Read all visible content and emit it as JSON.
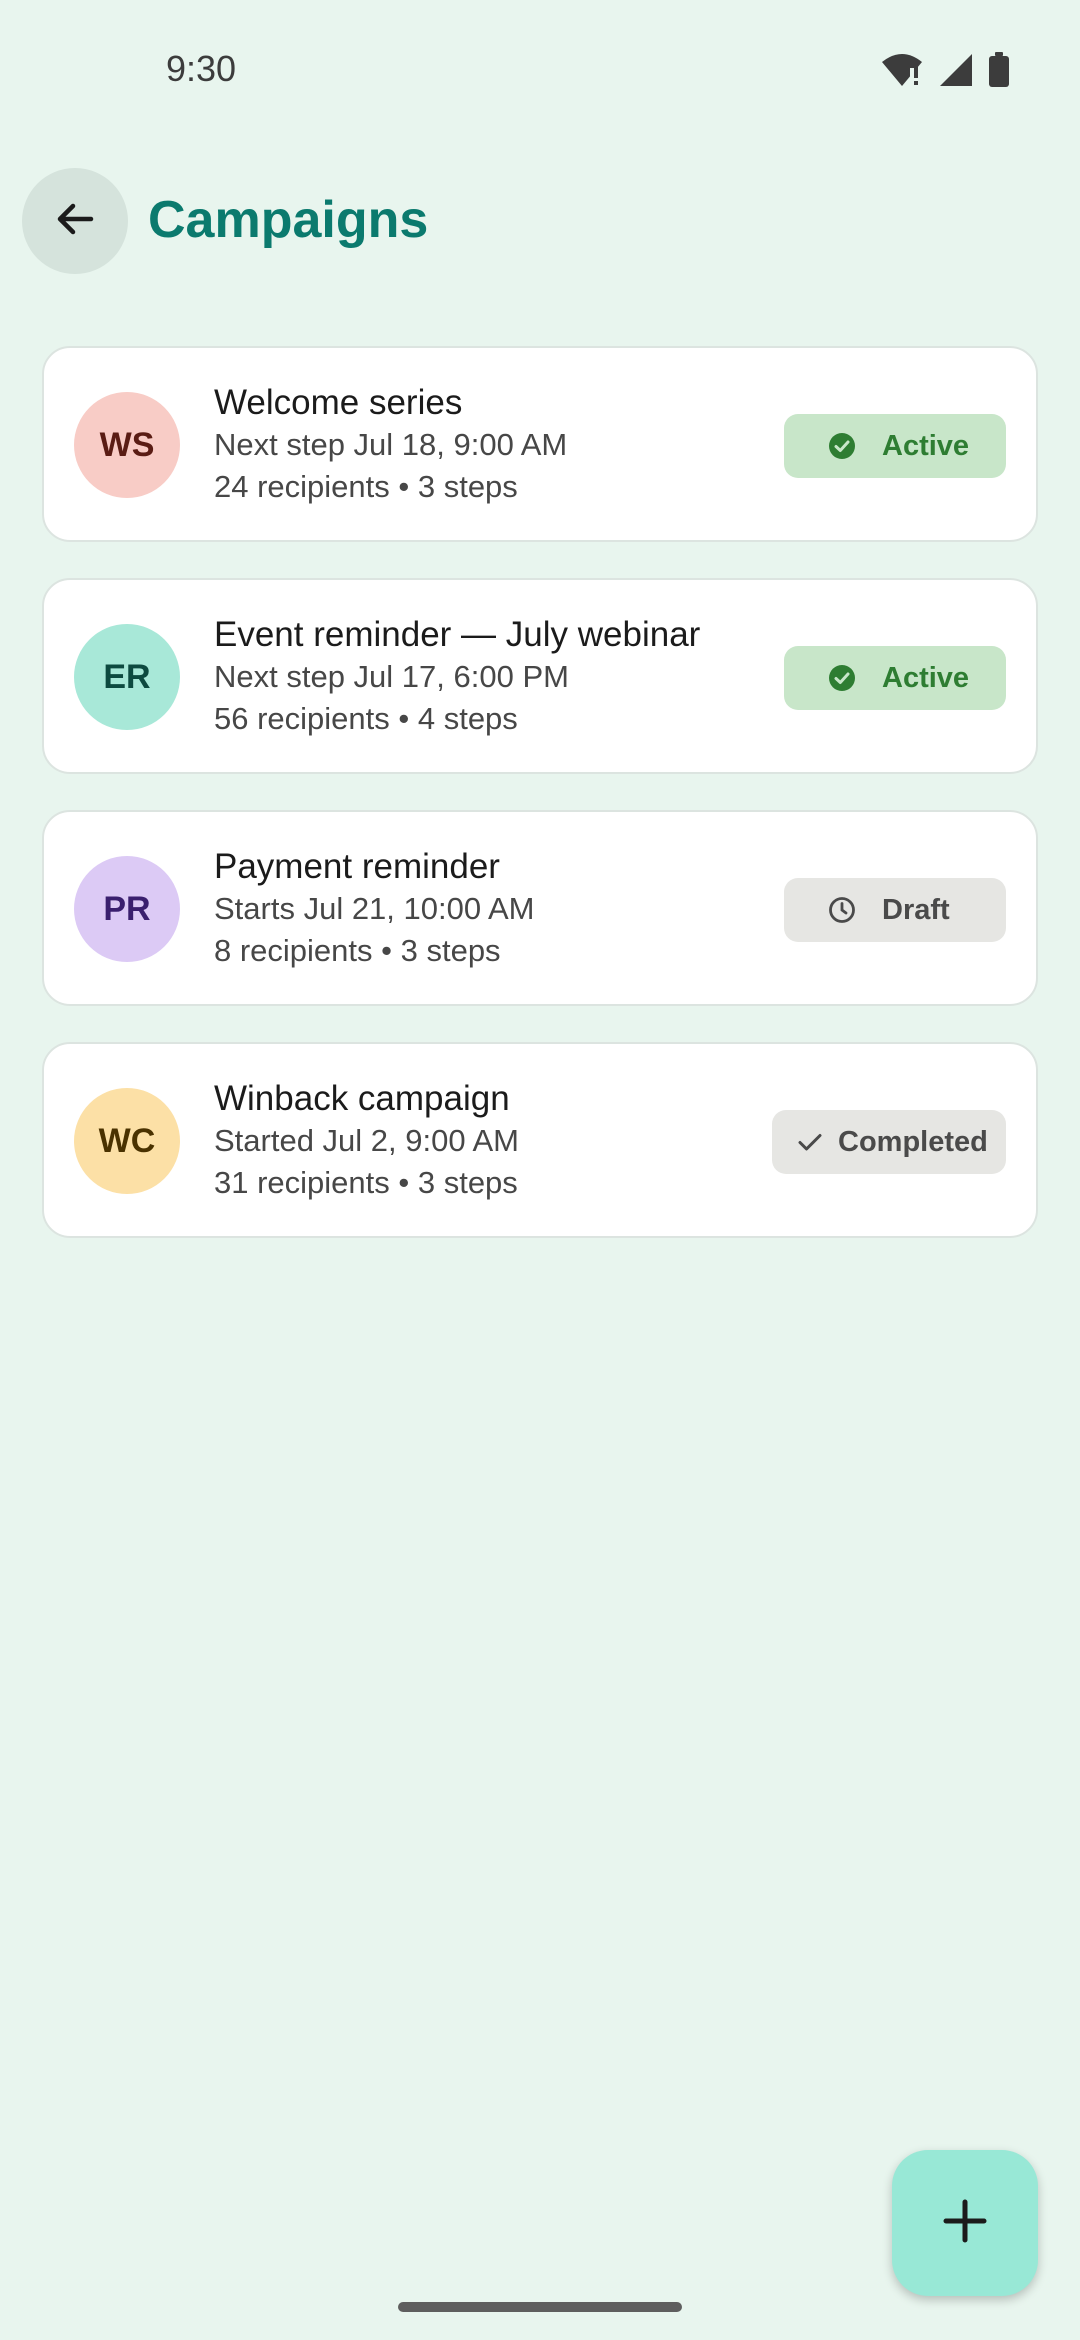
{
  "status_bar": {
    "time": "9:30",
    "icons": [
      "wifi-icon",
      "signal-icon",
      "battery-icon"
    ]
  },
  "app_bar": {
    "back_icon": "arrow-left-icon",
    "title": "Campaigns"
  },
  "campaigns": [
    {
      "initials": "WS",
      "avatar_bg": "#F8CCC6",
      "avatar_fg": "#5A1C14",
      "title": "Welcome series",
      "line1": "Next step Jul 18, 9:00 AM",
      "line2": "24 recipients • 3 steps",
      "status": "Active",
      "status_icon": "check-circle-icon"
    },
    {
      "initials": "ER",
      "avatar_bg": "#A8E8D8",
      "avatar_fg": "#0D4A40",
      "title": "Event reminder — July webinar",
      "line1": "Next step Jul 17, 6:00 PM",
      "line2": "56 recipients • 4 steps",
      "status": "Active",
      "status_icon": "check-circle-icon"
    },
    {
      "initials": "PR",
      "avatar_bg": "#DCCAF5",
      "avatar_fg": "#3A1F6E",
      "title": "Payment reminder",
      "line1": "Starts Jul 21, 10:00 AM",
      "line2": "8 recipients • 3 steps",
      "status": "Draft",
      "status_icon": "clock-icon"
    },
    {
      "initials": "WC",
      "avatar_bg": "#FCE0A6",
      "avatar_fg": "#4A3200",
      "title": "Winback campaign",
      "line1": "Started Jul 2, 9:00 AM",
      "line2": "31 recipients • 3 steps",
      "status": "Completed",
      "status_icon": "check-icon"
    }
  ],
  "fab": {
    "icon": "plus-icon"
  },
  "colors": {
    "background": "#E8F5EE",
    "title": "#0B7A6E",
    "active_badge": "#C8E6C9",
    "active_text": "#2E7D32",
    "neutral_badge": "#E6E6E3",
    "fab": "#98E8D6"
  }
}
